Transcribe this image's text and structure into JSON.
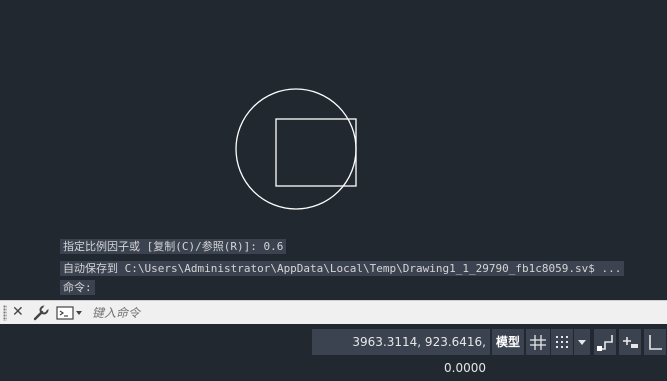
{
  "command_history": [
    "指定比例因子或 [复制(C)/参照(R)]: 0.6",
    "自动保存到 C:\\Users\\Administrator\\AppData\\Local\\Temp\\Drawing1_1_29790_fb1c8059.sv$ ...",
    "命令:"
  ],
  "command_line": {
    "placeholder": "键入命令"
  },
  "status_bar": {
    "coordinates": "3963.3114, 923.6416, 0.0000",
    "model_label": "模型",
    "icons": [
      "grid-icon",
      "snap-dots-icon",
      "dropdown-arrow-icon",
      "infer-constraints-icon",
      "dynamic-input-icon",
      "ortho-icon"
    ]
  },
  "colors": {
    "drawing_background": "#212830",
    "geometry_stroke": "#ffffff",
    "command_bar": "#f0f0f0"
  }
}
